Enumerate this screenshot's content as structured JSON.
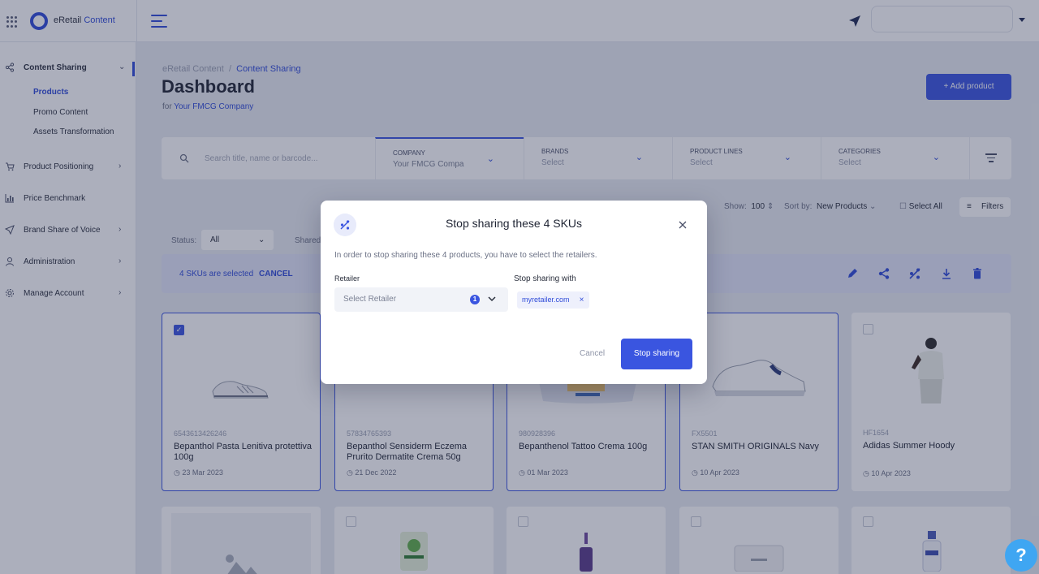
{
  "topbar": {
    "brand_prefix": "eRetail",
    "brand_accent": "Content"
  },
  "sidebar": {
    "sections": [
      {
        "label": "Content Sharing",
        "icon": "share-icon"
      },
      {
        "label": "Product Positioning",
        "icon": "cart-icon"
      },
      {
        "label": "Price Benchmark",
        "icon": "bar-chart-icon"
      },
      {
        "label": "Brand Share of Voice",
        "icon": "paper-plane-icon"
      },
      {
        "label": "Administration",
        "icon": "user-icon"
      },
      {
        "label": "Manage Account",
        "icon": "gear-icon"
      }
    ],
    "subitems": [
      "Products",
      "Promo Content",
      "Assets Transformation"
    ]
  },
  "breadcrumb": {
    "root": "eRetail Content",
    "sep": "/",
    "current": "Content Sharing"
  },
  "page": {
    "title": "Dashboard",
    "for_label": "for",
    "company": "Your FMCG Company",
    "add_button": "+ Add product"
  },
  "filters": {
    "search_placeholder": "Search title, name or barcode...",
    "columns": [
      {
        "label": "COMPANY",
        "value": "Your FMCG Compa"
      },
      {
        "label": "BRANDS",
        "value": "Select"
      },
      {
        "label": "PRODUCT LINES",
        "value": "Select"
      },
      {
        "label": "CATEGORIES",
        "value": "Select"
      }
    ]
  },
  "toolbar": {
    "show_label": "Show:",
    "show_value": "100",
    "sort_label": "Sort by:",
    "sort_value": "New Products",
    "select_all": "Select All",
    "filters": "Filters",
    "status_label": "Status:",
    "status_value": "All",
    "shared_label": "Shared"
  },
  "selection": {
    "text": "4 SKUs are selected",
    "cancel": "CANCEL"
  },
  "products": [
    {
      "code": "6543613426246",
      "name": "Bepanthol Pasta Lenitiva protettiva 100g",
      "date": "23 Mar 2023",
      "selected": true
    },
    {
      "code": "57834765393",
      "name": "Bepanthol Sensiderm Eczema Prurito Dermatite Crema 50g",
      "date": "21 Dec 2022",
      "selected": true
    },
    {
      "code": "980928396",
      "name": "Bepanthenol Tattoo Crema 100g",
      "date": "01 Mar 2023",
      "selected": true
    },
    {
      "code": "FX5501",
      "name": "STAN SMITH ORIGINALS Navy",
      "date": "10 Apr 2023",
      "selected": true
    },
    {
      "code": "HF1654",
      "name": "Adidas Summer Hoody",
      "date": "10 Apr 2023",
      "selected": false
    }
  ],
  "modal": {
    "title": "Stop sharing these 4 SKUs",
    "description": "In order to stop sharing these 4 products, you have to select the retailers.",
    "retailer_label": "Retailer",
    "retailer_placeholder": "Select Retailer",
    "retailer_count": "1",
    "stop_with_label": "Stop sharing with",
    "chip": "myretailer.com",
    "cancel": "Cancel",
    "confirm": "Stop sharing"
  },
  "help": {
    "label": "?"
  },
  "colors": {
    "accent": "#3a55e0",
    "help": "#3fa6f2"
  }
}
